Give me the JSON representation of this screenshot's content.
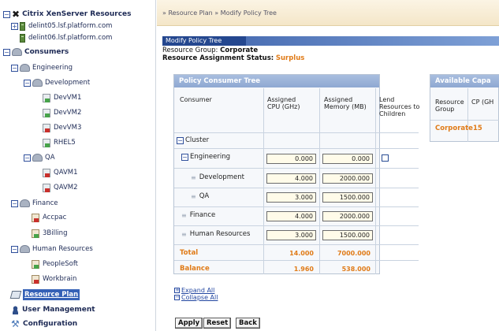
{
  "sidebar": {
    "root_label": "Citrix XenServer Resources",
    "servers": [
      "delint05.lsf.platform.com",
      "delint06.lsf.platform.com"
    ],
    "consumers_label": "Consumers",
    "engineering_label": "Engineering",
    "development_label": "Development",
    "dev_vms": [
      "DevVM1",
      "DevVM2",
      "DevVM3",
      "RHEL5"
    ],
    "qa_label": "QA",
    "qa_vms": [
      "QAVM1",
      "QAVM2"
    ],
    "finance_label": "Finance",
    "finance_items": [
      "Accpac",
      "3Billing"
    ],
    "hr_label": "Human Resources",
    "hr_items": [
      "PeopleSoft",
      "Workbrain"
    ],
    "resource_plan_label": "Resource Plan",
    "user_management_label": "User Management",
    "configuration_label": "Configuration"
  },
  "breadcrumb": "» Resource Plan » Modify Policy Tree",
  "modify_tab_label": "Modify Policy Tree",
  "resource_group_label": "Resource Group:",
  "resource_group_value": "Corporate",
  "assignment_status_label": "Resource Assignment Status:",
  "assignment_status_value": "Surplus",
  "policy_tree": {
    "title": "Policy Consumer Tree",
    "columns": [
      "Consumer",
      "Assigned CPU (GHz)",
      "Assigned Memory (MB)",
      "Lend Resources to Children"
    ],
    "rows": [
      {
        "label": "Cluster",
        "cpu": "",
        "mem": ""
      },
      {
        "label": "Engineering",
        "cpu": "0.000",
        "mem": "0.000"
      },
      {
        "label": "Development",
        "cpu": "4.000",
        "mem": "2000.000"
      },
      {
        "label": "QA",
        "cpu": "3.000",
        "mem": "1500.000"
      },
      {
        "label": "Finance",
        "cpu": "4.000",
        "mem": "2000.000"
      },
      {
        "label": "Human Resources",
        "cpu": "3.000",
        "mem": "1500.000"
      }
    ],
    "total_label": "Total",
    "total_cpu": "14.000",
    "total_mem": "7000.000",
    "balance_label": "Balance",
    "balance_cpu": "1.960",
    "balance_mem": "538.000"
  },
  "expand_all_label": "Expand All",
  "collapse_all_label": "Collapse All",
  "buttons": {
    "apply": "Apply",
    "reset": "Reset",
    "back": "Back"
  },
  "available": {
    "title": "Available Capa",
    "col_group": "Resource Group",
    "col_cpu": "CP (GH",
    "row_group": "Corporate",
    "row_cpu": "15"
  },
  "colors": {
    "accent": "#24478f",
    "orange": "#e07b18",
    "panel_header": "#8ea8d2"
  }
}
